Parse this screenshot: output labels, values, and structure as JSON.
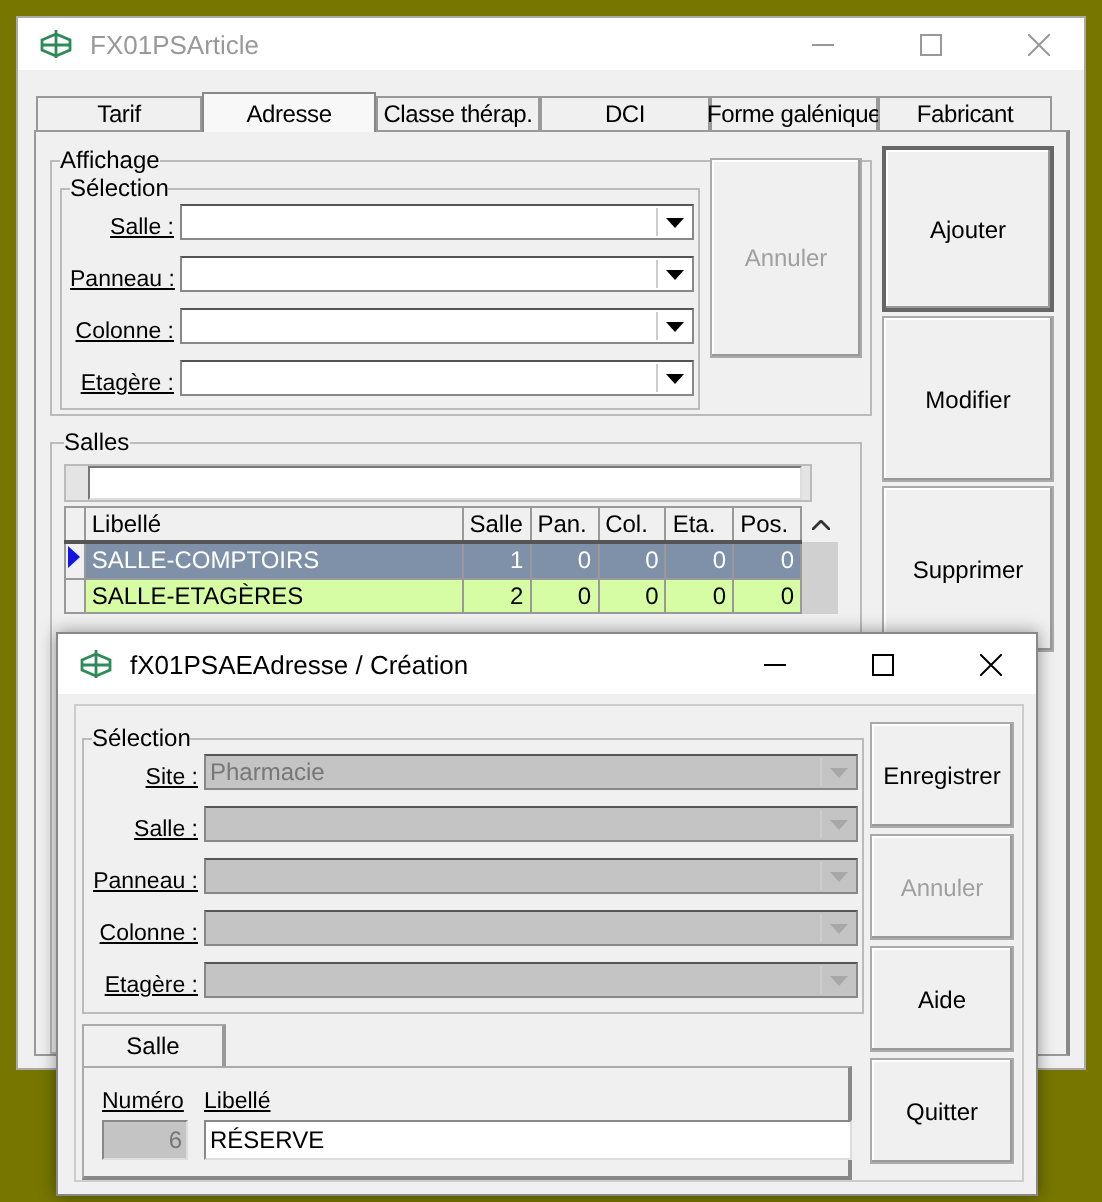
{
  "main_window": {
    "title": "FX01PSArticle",
    "active": false,
    "tabs": [
      {
        "label": "Tarif",
        "selected": false
      },
      {
        "label": "Adresse",
        "selected": true
      },
      {
        "label": "Classe thérap.",
        "selected": false
      },
      {
        "label": "DCI",
        "selected": false
      },
      {
        "label": "Forme galénique",
        "selected": false
      },
      {
        "label": "Fabricant",
        "selected": false
      }
    ],
    "affichage": {
      "title": "Affichage",
      "selection": {
        "title": "Sélection",
        "fields": [
          {
            "label": "Salle :"
          },
          {
            "label": "Panneau :"
          },
          {
            "label": "Colonne :"
          },
          {
            "label": "Etagère :"
          }
        ]
      },
      "cancel_button": {
        "label": "Annuler",
        "disabled": true
      }
    },
    "salles": {
      "title": "Salles",
      "columns": [
        "Libellé",
        "Salle",
        "Pan.",
        "Col.",
        "Eta.",
        "Pos."
      ],
      "rows": [
        {
          "cells": [
            "SALLE-COMPTOIRS",
            "1",
            "0",
            "0",
            "0",
            "0"
          ],
          "selected": true,
          "color": "#7f91a8"
        },
        {
          "cells": [
            "SALLE-ETAGÈRES",
            "2",
            "0",
            "0",
            "0",
            "0"
          ],
          "selected": false,
          "color": "#d6fca4"
        }
      ]
    },
    "buttons": [
      {
        "label": "Ajouter",
        "disabled": false,
        "default": true
      },
      {
        "label": "Modifier",
        "disabled": false,
        "default": false
      },
      {
        "label": "Supprimer",
        "disabled": false,
        "default": false
      }
    ]
  },
  "dialog": {
    "title": "fX01PSAEAdresse / Création",
    "active": true,
    "selection": {
      "title": "Sélection",
      "fields": [
        {
          "label": "Site :",
          "value": "Pharmacie",
          "disabled": true
        },
        {
          "label": "Salle :",
          "disabled": true
        },
        {
          "label": "Panneau :",
          "disabled": true
        },
        {
          "label": "Colonne :",
          "disabled": true
        },
        {
          "label": "Etagère :",
          "disabled": true
        }
      ]
    },
    "tab": {
      "label": "Salle",
      "selected": true
    },
    "numero": {
      "label": "Numéro",
      "value": "6",
      "disabled": true
    },
    "libelle": {
      "label": "Libellé",
      "value": "RÉSERVE",
      "disabled": false
    },
    "buttons": [
      {
        "label": "Enregistrer",
        "disabled": false
      },
      {
        "label": "Annuler",
        "disabled": true
      },
      {
        "label": "Aide",
        "disabled": false
      },
      {
        "label": "Quitter",
        "disabled": false
      }
    ]
  }
}
